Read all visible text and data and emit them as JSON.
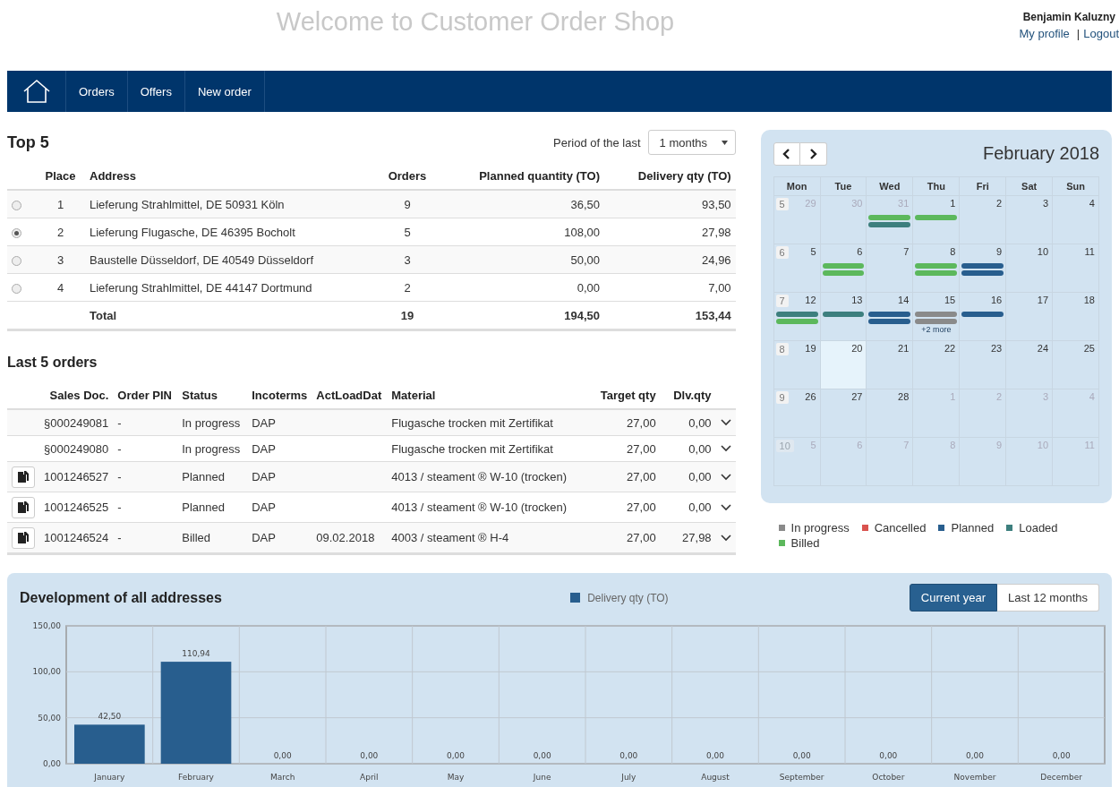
{
  "header": {
    "title": "Welcome to Customer Order Shop",
    "user_name": "Benjamin Kaluzny",
    "links": [
      "My profile",
      "Logout"
    ],
    "separator": "|"
  },
  "nav": {
    "items": [
      "Orders",
      "Offers",
      "New order"
    ]
  },
  "top5": {
    "title": "Top 5",
    "period_label": "Period of the last",
    "period_value": "1 months",
    "columns": [
      "Place",
      "Address",
      "Orders",
      "Planned quantity (TO)",
      "Delivery qty (TO)"
    ],
    "rows": [
      {
        "selected": false,
        "place": "1",
        "address": "Lieferung Strahlmittel, DE 50931 Köln",
        "orders": "9",
        "planned": "36,50",
        "delivery": "93,50"
      },
      {
        "selected": true,
        "place": "2",
        "address": "Lieferung Flugasche, DE 46395 Bocholt",
        "orders": "5",
        "planned": "108,00",
        "delivery": "27,98"
      },
      {
        "selected": false,
        "place": "3",
        "address": "Baustelle Düsseldorf, DE 40549 Düsseldorf",
        "orders": "3",
        "planned": "50,00",
        "delivery": "24,96"
      },
      {
        "selected": false,
        "place": "4",
        "address": "Lieferung Strahlmittel, DE 44147 Dortmund",
        "orders": "2",
        "planned": "0,00",
        "delivery": "7,00"
      }
    ],
    "total": {
      "label": "Total",
      "orders": "19",
      "planned": "194,50",
      "delivery": "153,44"
    }
  },
  "last_orders": {
    "title": "Last 5 orders",
    "columns": [
      "Sales Doc.",
      "Order PIN",
      "Status",
      "Incoterms",
      "ActLoadDat",
      "Material",
      "Target qty",
      "Dlv.qty"
    ],
    "rows": [
      {
        "copy_button": false,
        "sales_doc": "§000249081",
        "pin": "-",
        "status": "In progress",
        "incoterms": "DAP",
        "material": "Flugasche trocken mit Zertifikat",
        "target": "27,00",
        "dlv": "0,00"
      },
      {
        "copy_button": false,
        "sales_doc": "§000249080",
        "pin": "-",
        "status": "In progress",
        "incoterms": "DAP",
        "material": "Flugasche trocken mit Zertifikat",
        "target": "27,00",
        "dlv": "0,00"
      },
      {
        "copy_button": true,
        "sales_doc": "1001246527",
        "pin": "-",
        "status": "Planned",
        "incoterms": "DAP",
        "material": "4013 / steament ® W-10 (trocken)",
        "target": "27,00",
        "dlv": "0,00"
      },
      {
        "copy_button": true,
        "sales_doc": "1001246525",
        "pin": "-",
        "status": "Planned",
        "incoterms": "DAP",
        "material": "4013 / steament ® W-10 (trocken)",
        "target": "27,00",
        "dlv": "0,00"
      },
      {
        "copy_button": true,
        "sales_doc": "1001246524",
        "pin": "-",
        "status": "Billed",
        "incoterms": "DAP",
        "load_date": "09.02.2018",
        "material": "4003 / steament ® H-4",
        "target": "27,00",
        "dlv": "27,98"
      }
    ]
  },
  "calendar": {
    "title": "February 2018",
    "weekdays": [
      "Mon",
      "Tue",
      "Wed",
      "Thu",
      "Fri",
      "Sat",
      "Sun"
    ],
    "weeks": [
      {
        "number": "5",
        "muted": false,
        "days": [
          {
            "day": "29",
            "muted": true,
            "today": false
          },
          {
            "day": "30",
            "muted": true,
            "today": false
          },
          {
            "day": "31",
            "muted": true,
            "today": false,
            "events": [
              {
                "color": "#5cb85c"
              },
              {
                "color": "#3d7f7e"
              }
            ]
          },
          {
            "day": "1",
            "muted": false,
            "today": false,
            "events": [
              {
                "color": "#5cb85c"
              }
            ]
          },
          {
            "day": "2",
            "muted": false,
            "today": false
          },
          {
            "day": "3",
            "muted": false,
            "today": false
          },
          {
            "day": "4",
            "muted": false,
            "today": false
          }
        ]
      },
      {
        "number": "6",
        "muted": false,
        "days": [
          {
            "day": "5",
            "muted": false,
            "today": false
          },
          {
            "day": "6",
            "muted": false,
            "today": false,
            "events": [
              {
                "color": "#5cb85c"
              },
              {
                "color": "#5cb85c"
              }
            ]
          },
          {
            "day": "7",
            "muted": false,
            "today": false
          },
          {
            "day": "8",
            "muted": false,
            "today": false,
            "events": [
              {
                "color": "#5cb85c"
              },
              {
                "color": "#5cb85c"
              }
            ]
          },
          {
            "day": "9",
            "muted": false,
            "today": false,
            "events": [
              {
                "color": "#285e8e"
              },
              {
                "color": "#285e8e"
              }
            ]
          },
          {
            "day": "10",
            "muted": false,
            "today": false
          },
          {
            "day": "11",
            "muted": false,
            "today": false
          }
        ]
      },
      {
        "number": "7",
        "muted": false,
        "days": [
          {
            "day": "12",
            "muted": false,
            "today": false,
            "events": [
              {
                "color": "#3d7f7e"
              },
              {
                "color": "#5cb85c"
              }
            ]
          },
          {
            "day": "13",
            "muted": false,
            "today": false,
            "events": [
              {
                "color": "#3d7f7e"
              }
            ]
          },
          {
            "day": "14",
            "muted": false,
            "today": false,
            "events": [
              {
                "color": "#285e8e"
              },
              {
                "color": "#285e8e"
              }
            ]
          },
          {
            "day": "15",
            "muted": false,
            "today": false,
            "events": [
              {
                "color": "#8a8a8a"
              },
              {
                "color": "#8a8a8a"
              }
            ],
            "more": "+2 more"
          },
          {
            "day": "16",
            "muted": false,
            "today": false,
            "events": [
              {
                "color": "#285e8e"
              }
            ]
          },
          {
            "day": "17",
            "muted": false,
            "today": false
          },
          {
            "day": "18",
            "muted": false,
            "today": false
          }
        ]
      },
      {
        "number": "8",
        "muted": false,
        "days": [
          {
            "day": "19",
            "muted": false,
            "today": false
          },
          {
            "day": "20",
            "muted": false,
            "today": true
          },
          {
            "day": "21",
            "muted": false,
            "today": false
          },
          {
            "day": "22",
            "muted": false,
            "today": false
          },
          {
            "day": "23",
            "muted": false,
            "today": false
          },
          {
            "day": "24",
            "muted": false,
            "today": false
          },
          {
            "day": "25",
            "muted": false,
            "today": false
          }
        ]
      },
      {
        "number": "9",
        "muted": false,
        "days": [
          {
            "day": "26",
            "muted": false,
            "today": false
          },
          {
            "day": "27",
            "muted": false,
            "today": false
          },
          {
            "day": "28",
            "muted": false,
            "today": false
          },
          {
            "day": "1",
            "muted": true,
            "today": false
          },
          {
            "day": "2",
            "muted": true,
            "today": false
          },
          {
            "day": "3",
            "muted": true,
            "today": false
          },
          {
            "day": "4",
            "muted": true,
            "today": false
          }
        ]
      },
      {
        "number": "10",
        "muted": true,
        "days": [
          {
            "day": "5",
            "muted": true,
            "today": false
          },
          {
            "day": "6",
            "muted": true,
            "today": false
          },
          {
            "day": "7",
            "muted": true,
            "today": false
          },
          {
            "day": "8",
            "muted": true,
            "today": false
          },
          {
            "day": "9",
            "muted": true,
            "today": false
          },
          {
            "day": "10",
            "muted": true,
            "today": false
          },
          {
            "day": "11",
            "muted": true,
            "today": false
          }
        ]
      }
    ]
  },
  "legend": [
    {
      "label": "In progress",
      "color": "#8a8a8a"
    },
    {
      "label": "Cancelled",
      "color": "#d9534f"
    },
    {
      "label": "Planned",
      "color": "#285e8e"
    },
    {
      "label": "Loaded",
      "color": "#3d7f7e"
    },
    {
      "label": "Billed",
      "color": "#5cb85c"
    }
  ],
  "development": {
    "title": "Development of all addresses",
    "toggle": [
      {
        "label": "Current year",
        "selected": true
      },
      {
        "label": "Last 12 months",
        "selected": false
      }
    ],
    "chart_data": {
      "type": "bar",
      "categories": [
        "January",
        "February",
        "March",
        "April",
        "May",
        "June",
        "July",
        "August",
        "September",
        "October",
        "November",
        "December"
      ],
      "series": [
        {
          "name": "Delivery qty (TO)",
          "color": "#285e8e",
          "values": [
            42.5,
            110.94,
            0,
            0,
            0,
            0,
            0,
            0,
            0,
            0,
            0,
            0
          ]
        }
      ],
      "ylim": [
        0,
        150
      ],
      "yticks": [
        {
          "value": 0,
          "label": "0,00"
        },
        {
          "value": 50,
          "label": "50,00"
        },
        {
          "value": 100,
          "label": "100,00"
        },
        {
          "value": 150,
          "label": "150,00"
        }
      ],
      "value_labels": [
        "42,50",
        "110,94",
        "0,00",
        "0,00",
        "0,00",
        "0,00",
        "0,00",
        "0,00",
        "0,00",
        "0,00",
        "0,00",
        "0,00"
      ]
    }
  }
}
